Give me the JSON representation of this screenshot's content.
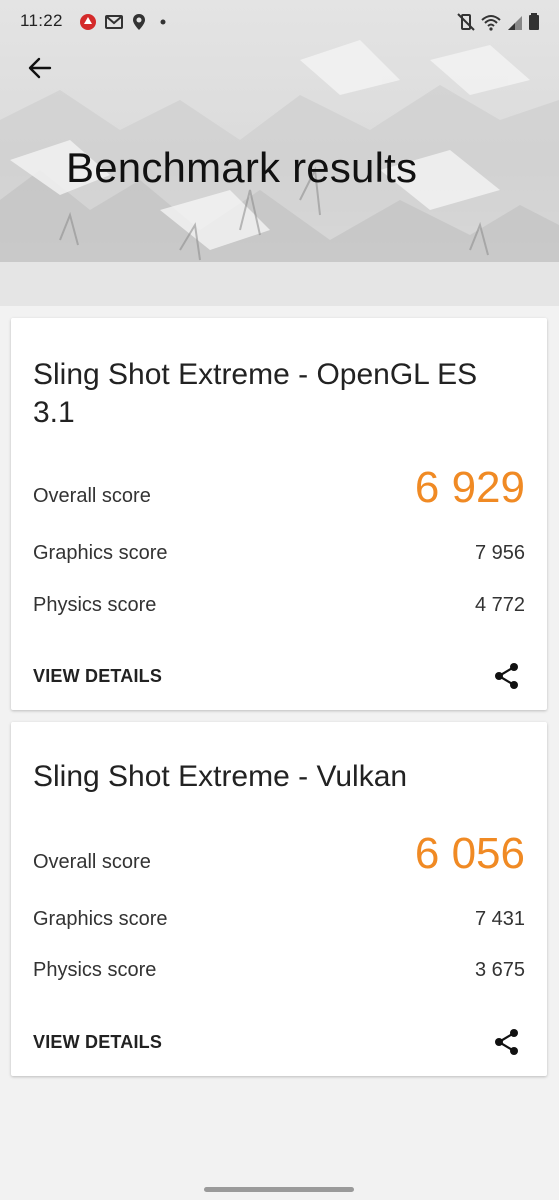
{
  "status_bar": {
    "time": "11:22",
    "left_icons": [
      "antutu-icon",
      "gmail-icon",
      "location-icon",
      "dot-icon"
    ],
    "right_icons": [
      "mute-vibrate-icon",
      "wifi-icon",
      "signal-icon",
      "battery-icon"
    ]
  },
  "header": {
    "title": "Benchmark results"
  },
  "results": [
    {
      "title": "Sling Shot Extreme - OpenGL ES 3.1",
      "overall_label": "Overall score",
      "overall_value": "6 929",
      "graphics_label": "Graphics score",
      "graphics_value": "7 956",
      "physics_label": "Physics score",
      "physics_value": "4 772",
      "details_label": "VIEW DETAILS"
    },
    {
      "title": "Sling Shot Extreme - Vulkan",
      "overall_label": "Overall score",
      "overall_value": "6 056",
      "graphics_label": "Graphics score",
      "graphics_value": "7 431",
      "physics_label": "Physics score",
      "physics_value": "3 675",
      "details_label": "VIEW DETAILS"
    }
  ],
  "colors": {
    "score_accent": "#f08a24",
    "background": "#f2f2f2",
    "card": "#ffffff"
  }
}
